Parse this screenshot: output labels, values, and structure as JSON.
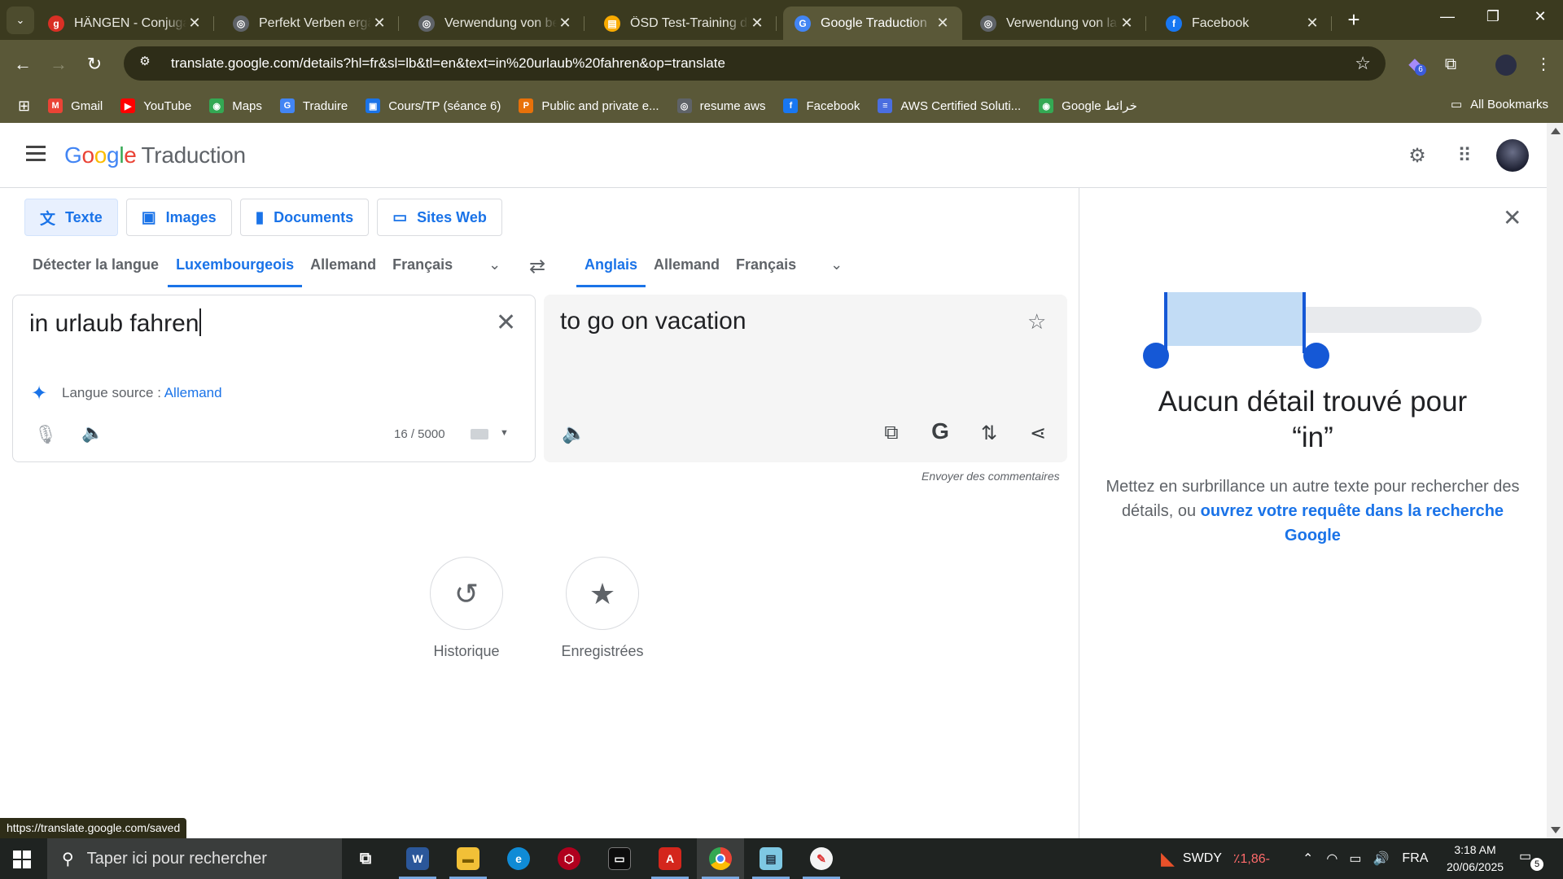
{
  "browser": {
    "tabs": [
      {
        "title": "HÄNGEN - Conjugaison",
        "fav_color": "#d93025",
        "fav_glyph": "g",
        "close": "✕"
      },
      {
        "title": "Perfekt Verben ergänzen",
        "fav_color": "#5f6368",
        "fav_glyph": "◎",
        "close": "✕"
      },
      {
        "title": "Verwendung von bestimmten",
        "fav_color": "#5f6368",
        "fav_glyph": "◎",
        "close": "✕"
      },
      {
        "title": "ÖSD Test-Training digital",
        "fav_color": "#f9ab00",
        "fav_glyph": "▤",
        "close": "✕"
      },
      {
        "title": "Google Traduction",
        "fav_color": "#4285f4",
        "fav_glyph": "G",
        "close": "✕"
      },
      {
        "title": "Verwendung von laufen",
        "fav_color": "#5f6368",
        "fav_glyph": "◎",
        "close": "✕"
      },
      {
        "title": "Facebook",
        "fav_color": "#1877f2",
        "fav_glyph": "f",
        "close": "✕"
      }
    ],
    "new_tab": "+",
    "url": "translate.google.com/details?hl=fr&sl=lb&tl=en&text=in%20urlaub%20fahren&op=translate",
    "extension_badge": "6",
    "bookmarks": [
      {
        "label": "Gmail",
        "color": "#ea4335",
        "glyph": "M"
      },
      {
        "label": "YouTube",
        "color": "#ff0000",
        "glyph": "▶"
      },
      {
        "label": "Maps",
        "color": "#34a853",
        "glyph": "◉"
      },
      {
        "label": "Traduire",
        "color": "#4285f4",
        "glyph": "G"
      },
      {
        "label": "Cours/TP (séance 6)",
        "color": "#1a73e8",
        "glyph": "▣"
      },
      {
        "label": "Public and private e...",
        "color": "#e8710a",
        "glyph": "P"
      },
      {
        "label": "resume aws",
        "color": "#5f6368",
        "glyph": "◎"
      },
      {
        "label": "Facebook",
        "color": "#1877f2",
        "glyph": "f"
      },
      {
        "label": "AWS Certified Soluti...",
        "color": "#4a6ee0",
        "glyph": "≡"
      },
      {
        "label": "Google خرائط",
        "color": "#34a853",
        "glyph": "◉"
      }
    ],
    "all_bookmarks": "All Bookmarks",
    "status_url": "https://translate.google.com/saved"
  },
  "app": {
    "logo_letters": [
      {
        "ch": "G",
        "color": "#4285f4"
      },
      {
        "ch": "o",
        "color": "#ea4335"
      },
      {
        "ch": "o",
        "color": "#fbbc04"
      },
      {
        "ch": "g",
        "color": "#4285f4"
      },
      {
        "ch": "l",
        "color": "#34a853"
      },
      {
        "ch": "e",
        "color": "#ea4335"
      }
    ],
    "product": "Traduction",
    "modes": [
      "Texte",
      "Images",
      "Documents",
      "Sites Web"
    ],
    "source_langs": [
      "Détecter la langue",
      "Luxembourgeois",
      "Allemand",
      "Français"
    ],
    "target_langs": [
      "Anglais",
      "Allemand",
      "Français"
    ],
    "source_text": "in urlaub fahren",
    "source_hint_prefix": "Langue source :",
    "source_hint_link": "Allemand",
    "char_count": "16 / 5000",
    "translation": "to go on vacation",
    "feedback": "Envoyer des commentaires",
    "shortcuts": [
      "Historique",
      "Enregistrées"
    ]
  },
  "details_panel": {
    "title_line1": "Aucun détail trouvé pour",
    "title_line2": "“in”",
    "desc_text": "Mettez en surbrillance un autre texte pour rechercher des détails, ou ",
    "desc_link": "ouvrez votre requête dans la recherche Google"
  },
  "taskbar": {
    "search_placeholder": "Taper ici pour rechercher",
    "weather": "SWDY",
    "weather_change": "٪1,86-",
    "lang": "FRA",
    "time": "3:18 AM",
    "date": "20/06/2025",
    "notif_count": "5"
  },
  "colors": {
    "accent": "#1a73e8",
    "chrome": "#5a5838"
  }
}
